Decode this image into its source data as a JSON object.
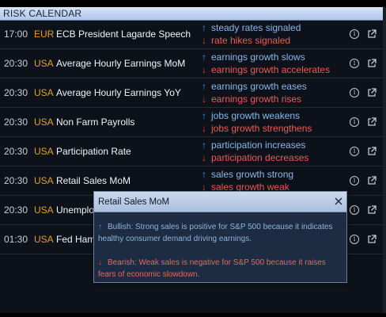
{
  "calendar": {
    "title": "RISK CALENDAR",
    "rows": [
      {
        "time": "17:00",
        "country": "EUR",
        "event": "ECB President Lagarde Speech",
        "bullish": "steady rates signaled",
        "bearish": "rate hikes signaled"
      },
      {
        "time": "20:30",
        "country": "USA",
        "event": "Average Hourly Earnings MoM",
        "bullish": "earnings growth slows",
        "bearish": "earnings growth accelerates"
      },
      {
        "time": "20:30",
        "country": "USA",
        "event": "Average Hourly Earnings YoY",
        "bullish": "earnings growth eases",
        "bearish": "earnings growth rises"
      },
      {
        "time": "20:30",
        "country": "USA",
        "event": "Non Farm Payrolls",
        "bullish": "jobs growth weakens",
        "bearish": "jobs growth strengthens"
      },
      {
        "time": "20:30",
        "country": "USA",
        "event": "Participation Rate",
        "bullish": "participation increases",
        "bearish": "participation decreases"
      },
      {
        "time": "20:30",
        "country": "USA",
        "event": "Retail Sales MoM",
        "bullish": "sales growth strong",
        "bearish": "sales growth weak"
      },
      {
        "time": "20:30",
        "country": "USA",
        "event": "Unemploy",
        "bullish": "",
        "bearish": ""
      },
      {
        "time": "01:30",
        "country": "USA",
        "event": "Fed Hamm",
        "bullish": "",
        "bearish": ""
      }
    ]
  },
  "popup": {
    "title": "Retail Sales MoM",
    "bullish": "Bullish: Strong sales is positive for S&P 500 because it indicates healthy consumer demand driving earnings.",
    "bearish": "Bearish: Weak sales is negative for S&P 500 because it raises fears of economic slowdown."
  },
  "icons": {
    "info": "info-icon",
    "external_link": "external-link-icon",
    "close": "close-icon",
    "bullish_arrow": "up-arrow-icon",
    "bearish_arrow": "down-arrow-icon"
  },
  "colors": {
    "background": "#0c111a",
    "header": "#c4d6ef",
    "time": "#c8ced8",
    "country": "#e0a32a",
    "event": "#f2f4f7",
    "bullish_text": "#8ab8e8",
    "bearish_text": "#ee5b55",
    "bullish_arrow": "#3f9ae6",
    "bearish_arrow": "#e84036",
    "popup_background": "#1d2c43"
  }
}
